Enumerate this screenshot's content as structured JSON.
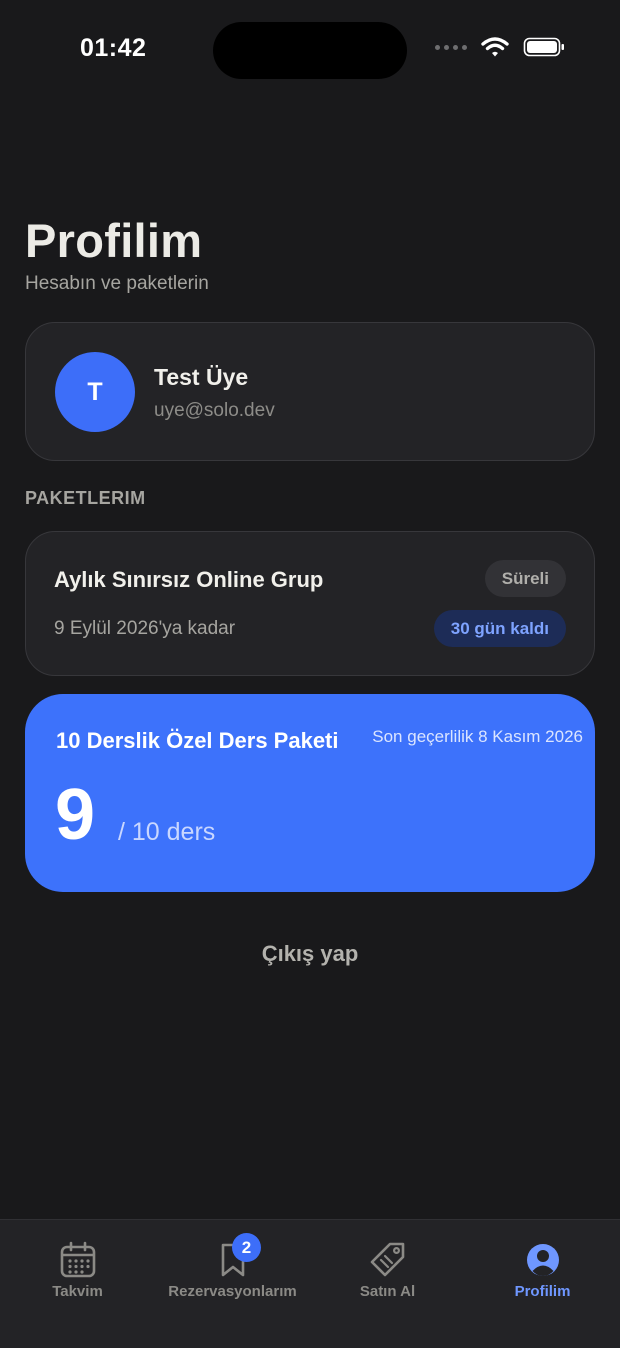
{
  "status_bar": {
    "time": "01:42"
  },
  "header": {
    "title": "Profilim",
    "subtitle": "Hesabın ve paketlerin"
  },
  "profile": {
    "initial": "T",
    "name": "Test Üye",
    "email": "uye@solo.dev"
  },
  "packages_section": {
    "label": "PAKETLERIM"
  },
  "packages": [
    {
      "name": "Aylık Sınırsız Online Grup",
      "type_badge": "Süreli",
      "expiry": "9 Eylül 2026'ya kadar",
      "remaining_badge": "30 gün kaldı"
    }
  ],
  "credit_package": {
    "name": "10 Derslik Özel Ders Paketi",
    "validity": "Son geçerlilik 8 Kasım 2026",
    "remaining": "9",
    "total": "/ 10 ders",
    "remaining_fraction": 0.9
  },
  "logout_label": "Çıkış yap",
  "tabbar": {
    "tabs": [
      {
        "label": "Takvim",
        "icon": "calendar-icon"
      },
      {
        "label": "Rezervasyonlarım",
        "icon": "bookmark-icon",
        "badge": "2"
      },
      {
        "label": "Satın Al",
        "icon": "tag-icon"
      },
      {
        "label": "Profilim",
        "icon": "user-icon",
        "active": true
      }
    ]
  },
  "colors": {
    "accent": "#3d6ef9",
    "background": "#19191b",
    "card": "#232326",
    "active_tab": "#6f97ff"
  }
}
